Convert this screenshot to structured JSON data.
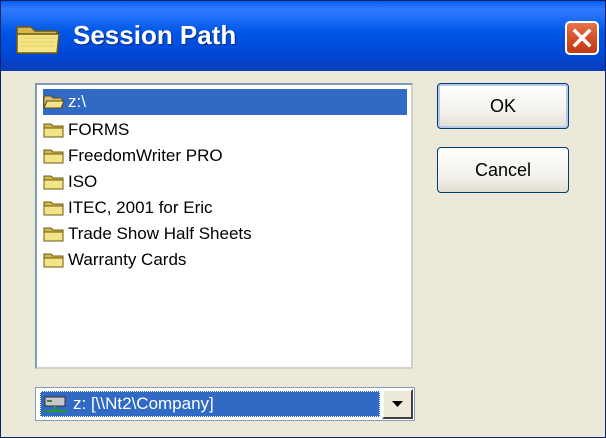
{
  "window": {
    "title": "Session Path",
    "app_icon": "folder-icon",
    "close_icon": "close-icon"
  },
  "folder_list": {
    "items": [
      {
        "label": "z:\\",
        "icon": "open-folder-icon",
        "selected": true
      },
      {
        "label": "FORMS",
        "icon": "folder-icon"
      },
      {
        "label": "FreedomWriter PRO",
        "icon": "folder-icon"
      },
      {
        "label": "ISO",
        "icon": "folder-icon"
      },
      {
        "label": "ITEC, 2001 for Eric",
        "icon": "folder-icon"
      },
      {
        "label": "Trade Show Half Sheets",
        "icon": "folder-icon"
      },
      {
        "label": "Warranty Cards",
        "icon": "folder-icon"
      }
    ]
  },
  "buttons": {
    "ok_label": "OK",
    "cancel_label": "Cancel"
  },
  "drive_select": {
    "value": "z: [\\\\Nt2\\Company]",
    "icon": "network-drive-icon"
  },
  "colors": {
    "selection": "#316ac5",
    "titlebar": "#0055e5",
    "dialog_background": "#ece9d8",
    "close_button": "#d8502a"
  }
}
